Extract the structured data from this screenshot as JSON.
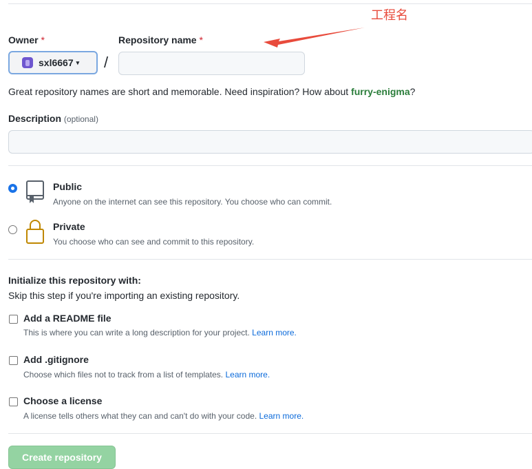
{
  "annotation": {
    "text": "工程名",
    "color": "#e84b3c"
  },
  "owner": {
    "label": "Owner",
    "required_mark": "*",
    "value": "sxl6667",
    "caret": "▾"
  },
  "slash": "/",
  "repo": {
    "label": "Repository name",
    "required_mark": "*",
    "value": ""
  },
  "name_hint": {
    "before": "Great repository names are short and memorable. Need inspiration? How about ",
    "suggestion": "furry-enigma",
    "after": "?"
  },
  "description": {
    "label": "Description",
    "optional": "(optional)",
    "value": ""
  },
  "visibility": {
    "public": {
      "title": "Public",
      "desc": "Anyone on the internet can see this repository. You choose who can commit.",
      "checked": true
    },
    "private": {
      "title": "Private",
      "desc": "You choose who can see and commit to this repository.",
      "checked": false
    }
  },
  "init": {
    "title": "Initialize this repository with:",
    "subtitle": "Skip this step if you're importing an existing repository.",
    "readme": {
      "label": "Add a README file",
      "desc": "This is where you can write a long description for your project.",
      "link": "Learn more."
    },
    "gitignore": {
      "label": "Add .gitignore",
      "desc": "Choose which files not to track from a list of templates.",
      "link": "Learn more."
    },
    "license": {
      "label": "Choose a license",
      "desc": "A license tells others what they can and can't do with your code.",
      "link": "Learn more."
    }
  },
  "create_button": "Create repository"
}
